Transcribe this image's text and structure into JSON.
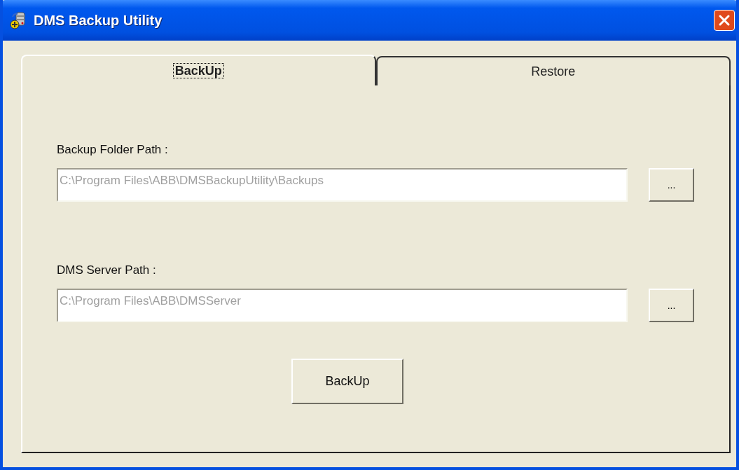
{
  "window": {
    "title": "DMS Backup Utility"
  },
  "tabs": [
    {
      "label": "BackUp",
      "selected": true
    },
    {
      "label": "Restore",
      "selected": false
    }
  ],
  "fields": [
    {
      "label": "Backup Folder Path :",
      "value": "C:\\Program Files\\ABB\\DMSBackupUtility\\Backups",
      "disabled": true,
      "browse": "..."
    },
    {
      "label": "DMS Server Path :",
      "value": "C:\\Program Files\\ABB\\DMSServer",
      "disabled": true,
      "browse": "..."
    }
  ],
  "action": {
    "label": "BackUp"
  }
}
